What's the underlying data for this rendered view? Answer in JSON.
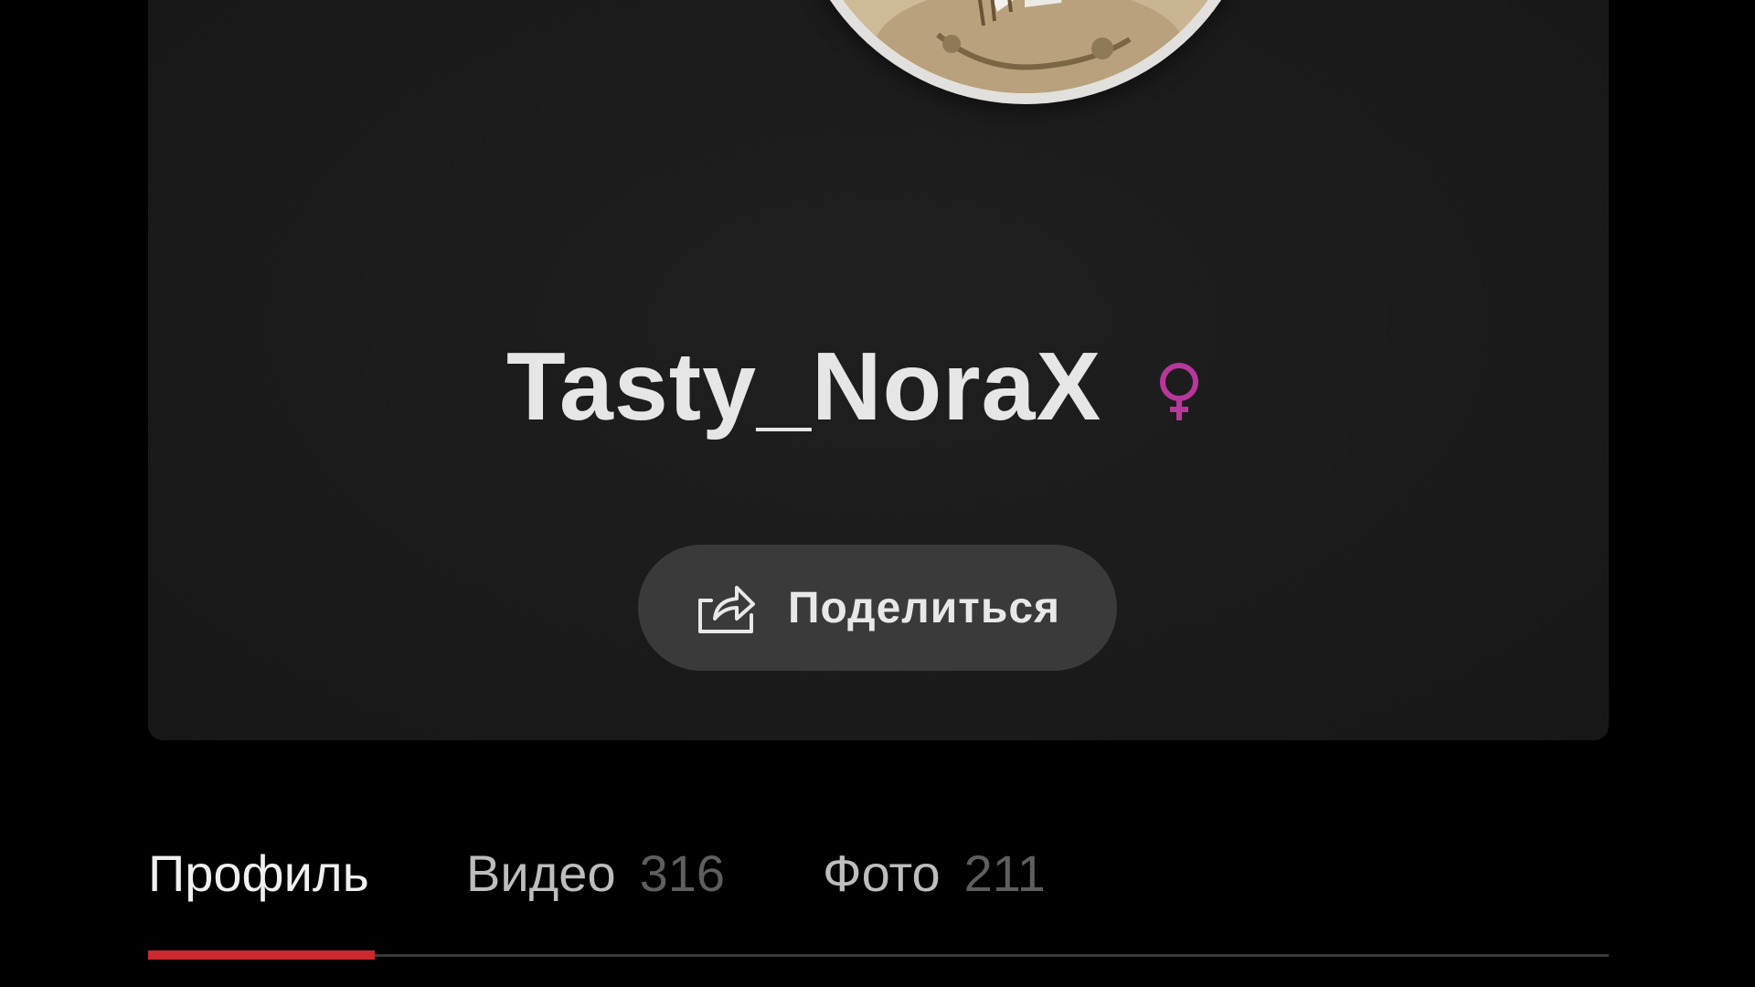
{
  "profile": {
    "username": "Tasty_NoraX",
    "gender_icon": "female-symbol-icon",
    "gender_color": "#b8379b"
  },
  "share": {
    "label": "Поделиться",
    "icon": "share-arrow-icon"
  },
  "tabs": [
    {
      "label": "Профиль",
      "count": "",
      "active": true
    },
    {
      "label": "Видео",
      "count": "316",
      "active": false
    },
    {
      "label": "Фото",
      "count": "211",
      "active": false
    }
  ],
  "colors": {
    "background": "#000000",
    "card": "#1b1b1b",
    "share_button": "#3a3a3a",
    "active_tab_indicator": "#cc2a2f"
  }
}
